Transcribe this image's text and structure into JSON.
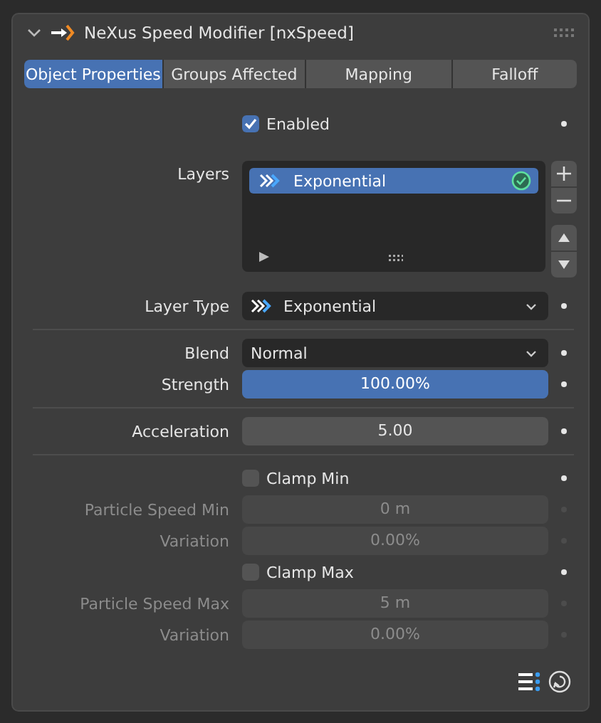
{
  "header": {
    "title": "NeXus Speed Modifier [nxSpeed]",
    "expanded": true
  },
  "tabs": [
    {
      "label": "Object Properties",
      "selected": true
    },
    {
      "label": "Groups Affected",
      "selected": false
    },
    {
      "label": "Mapping",
      "selected": false
    },
    {
      "label": "Falloff",
      "selected": false
    }
  ],
  "rows": [
    {
      "kind": "checkbox",
      "label": "Enabled",
      "checked": true,
      "disabled": false
    },
    {
      "kind": "list",
      "label": "Layers",
      "items": [
        {
          "name": "Exponential",
          "selected": true,
          "checked": true
        }
      ]
    },
    {
      "kind": "dropdown",
      "label": "Layer Type",
      "value": "Exponential",
      "icon": true
    },
    {
      "kind": "separator"
    },
    {
      "kind": "dropdown",
      "label": "Blend",
      "value": "Normal",
      "icon": false
    },
    {
      "kind": "slider",
      "label": "Strength",
      "value": "100.00%",
      "level": 1
    },
    {
      "kind": "separator"
    },
    {
      "kind": "number",
      "label": "Acceleration",
      "value": "5.00",
      "disabled": false
    },
    {
      "kind": "separator"
    },
    {
      "kind": "checkbox",
      "label": "Clamp Min",
      "checked": false,
      "disabled": false
    },
    {
      "kind": "number",
      "label": "Particle Speed Min",
      "value": "0 m",
      "disabled": true
    },
    {
      "kind": "number",
      "label": "Variation",
      "value": "0.00%",
      "disabled": true
    },
    {
      "kind": "checkbox",
      "label": "Clamp Max",
      "checked": false,
      "disabled": false
    },
    {
      "kind": "number",
      "label": "Particle Speed Max",
      "value": "5 m",
      "disabled": true
    },
    {
      "kind": "number",
      "label": "Variation",
      "value": "0.00%",
      "disabled": true
    }
  ]
}
